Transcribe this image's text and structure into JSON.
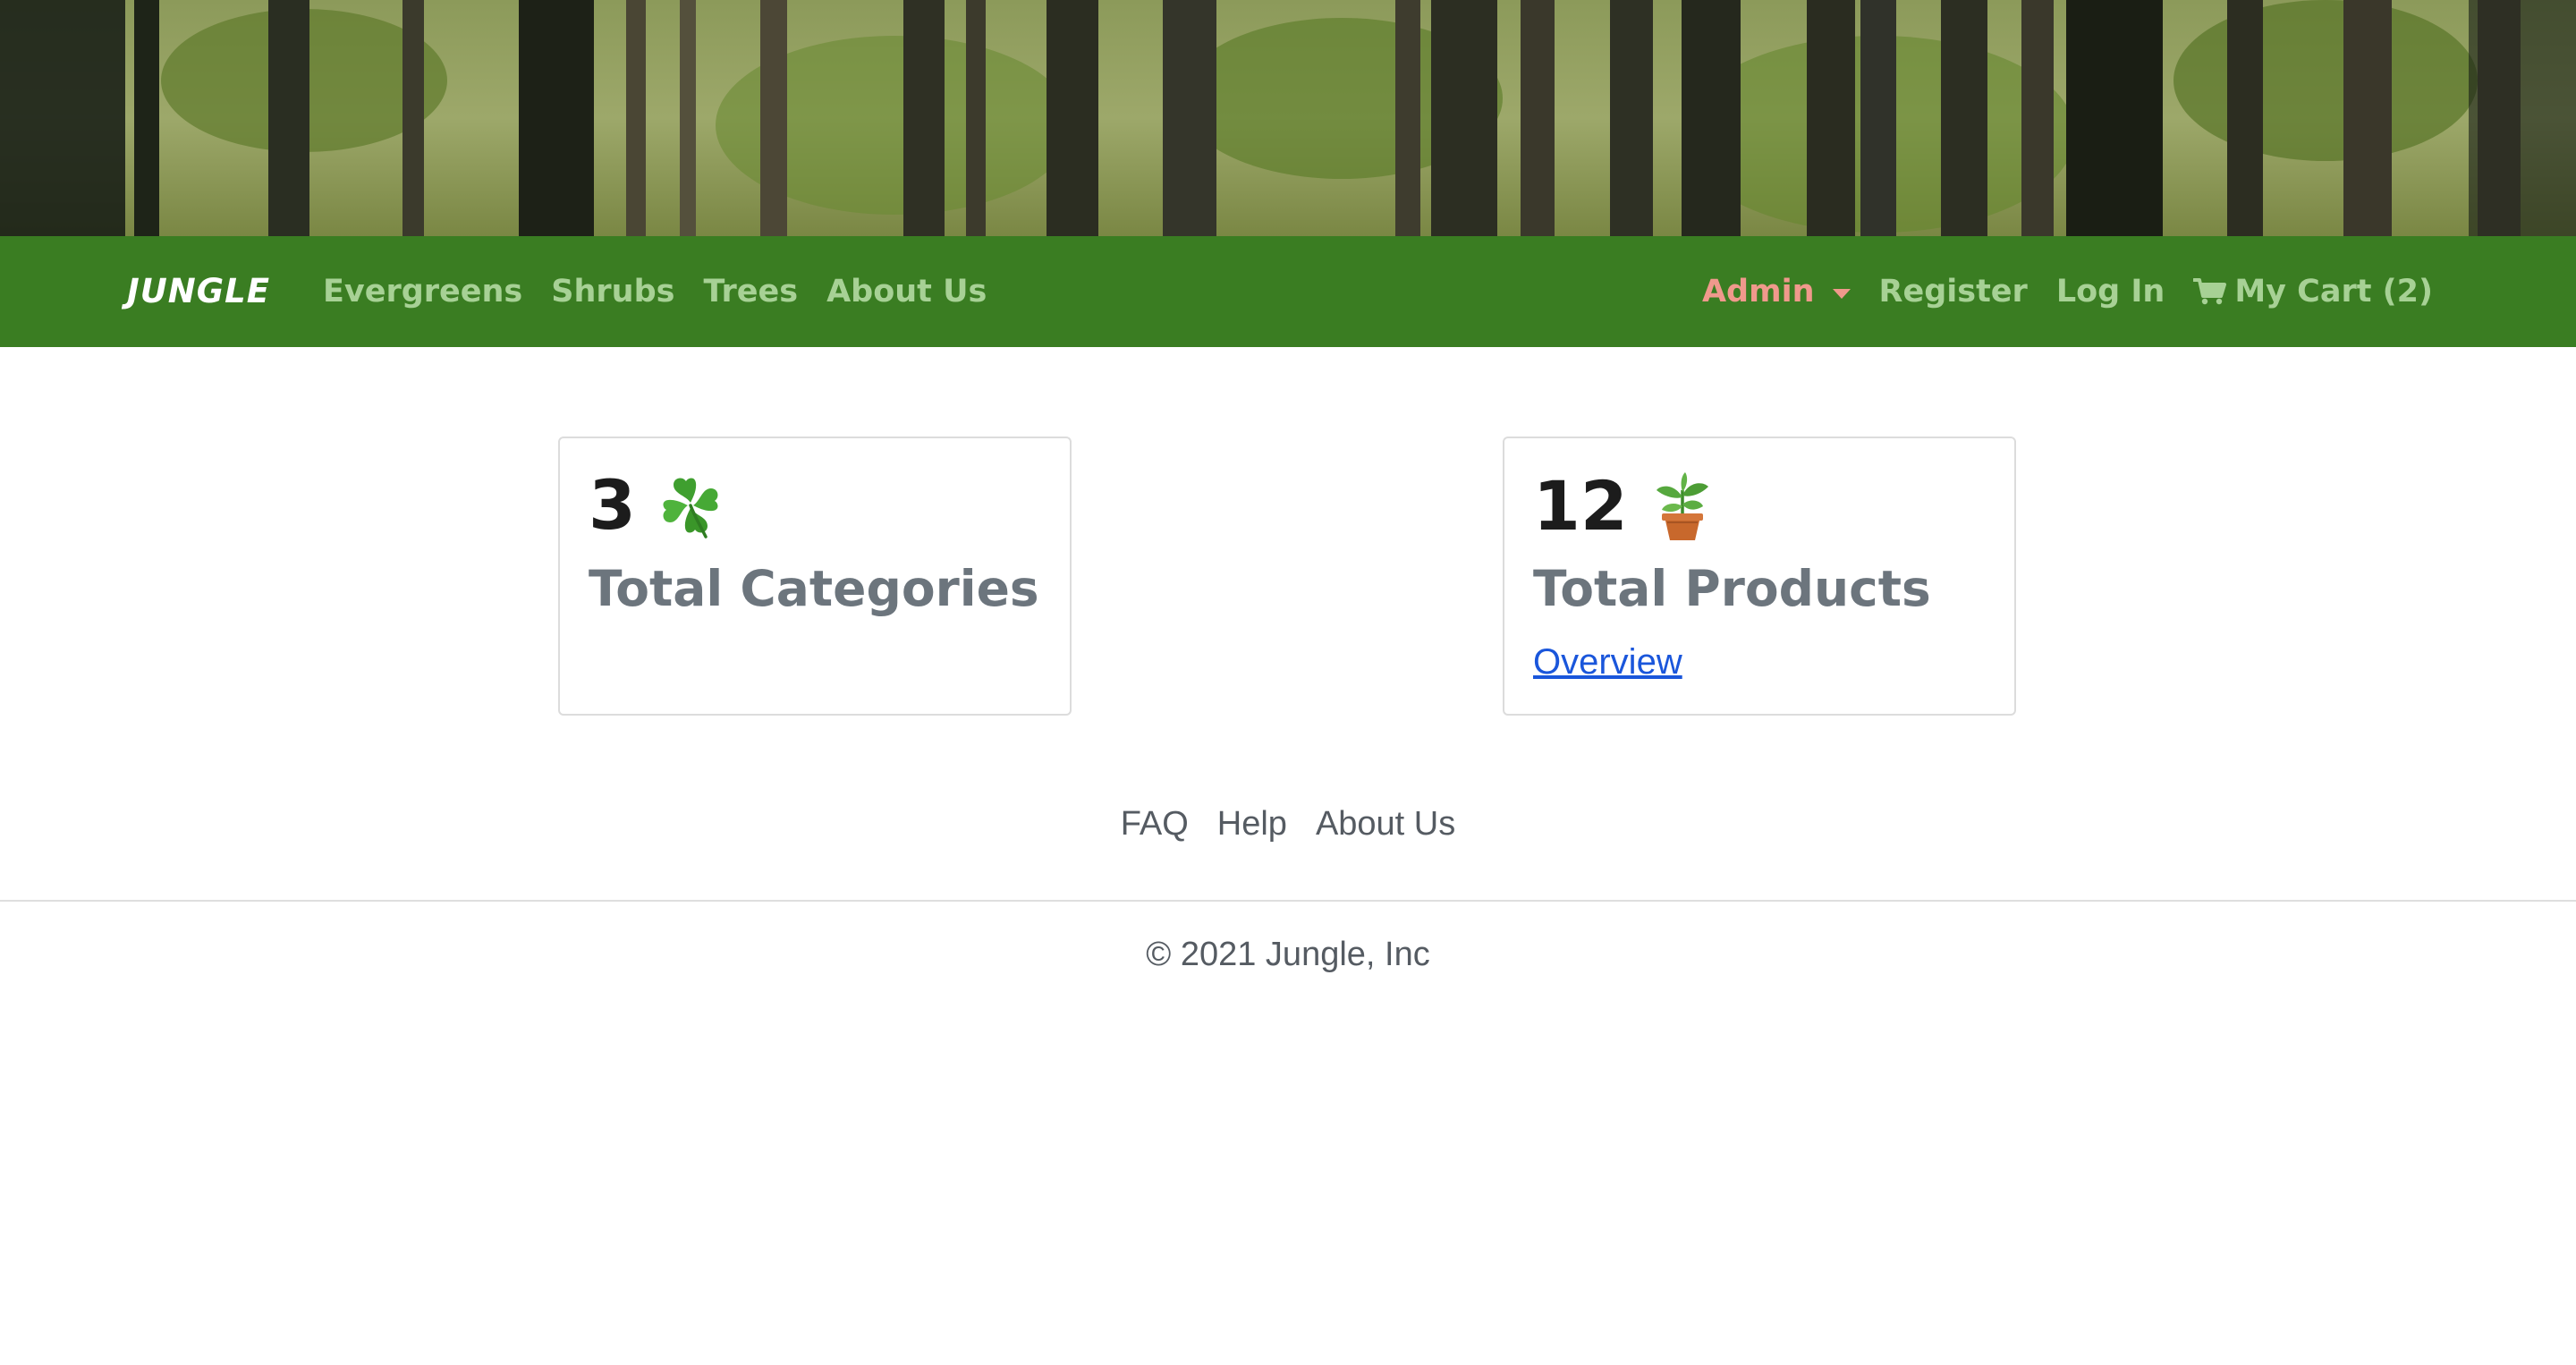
{
  "banner": {
    "image": "forest-trees"
  },
  "navbar": {
    "brand": "JUNGLE",
    "links": [
      {
        "label": "Evergreens"
      },
      {
        "label": "Shrubs"
      },
      {
        "label": "Trees"
      },
      {
        "label": "About Us"
      }
    ],
    "admin_label": "Admin",
    "register_label": "Register",
    "login_label": "Log In",
    "cart_label": "My Cart (2)",
    "cart_icon": "shopping-cart-icon",
    "colors": {
      "bar": "#3a7d22",
      "link": "#a7d195",
      "admin": "#f0998c"
    }
  },
  "stats": {
    "categories": {
      "count": "3",
      "label": "Total Categories",
      "icon": "four-leaf-clover-icon"
    },
    "products": {
      "count": "12",
      "label": "Total Products",
      "icon": "potted-plant-icon",
      "link_label": "Overview"
    }
  },
  "footer": {
    "links": [
      {
        "label": "FAQ"
      },
      {
        "label": "Help"
      },
      {
        "label": "About Us"
      }
    ],
    "copyright": "© 2021 Jungle, Inc"
  }
}
